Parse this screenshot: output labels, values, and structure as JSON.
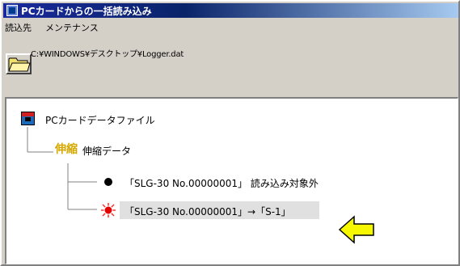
{
  "window": {
    "title": "PCカードからの一括読み込み"
  },
  "menu": {
    "items": [
      "読込先",
      "メンテナンス"
    ]
  },
  "toolbar": {
    "path": "C:¥WINDOWS¥デスクトップ¥Logger.dat"
  },
  "tree": {
    "root_label": "PCカードデータファイル",
    "compress_icon_text": "伸縮",
    "compress_label": "伸縮データ",
    "items": [
      {
        "label": "「SLG-30 No.00000001」 読み込み対象外",
        "status": "black-dot"
      },
      {
        "label": "「SLG-30 No.00000001」→「S-1」",
        "status": "red-burst"
      }
    ]
  },
  "colors": {
    "arrow_fill": "#f7f700",
    "selection_bg": "#e0e0e0",
    "title_bar": "#0a246a"
  }
}
